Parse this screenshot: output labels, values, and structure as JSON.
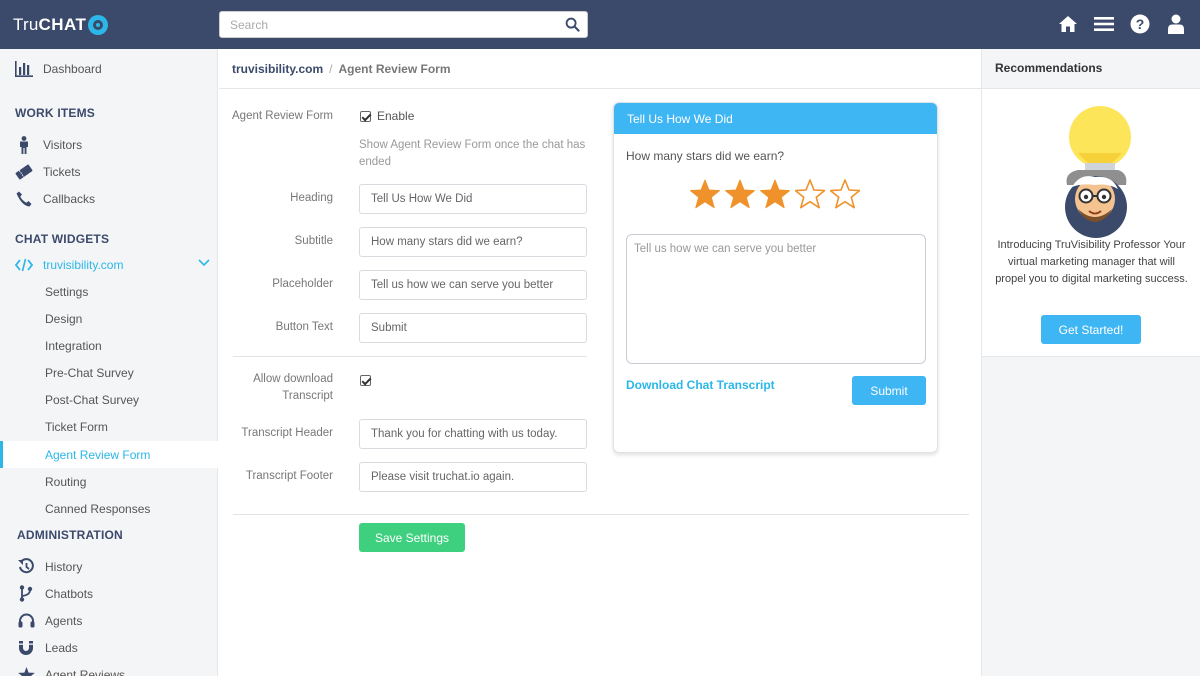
{
  "app": {
    "logo_tru": "Tru",
    "logo_chat": "CHAT"
  },
  "search": {
    "placeholder": "Search"
  },
  "topbar_icons": [
    "home-icon",
    "menu-icon",
    "help-icon",
    "user-icon"
  ],
  "sidebar": {
    "dashboard": "Dashboard",
    "work_items_title": "WORK ITEMS",
    "work_items": [
      "Visitors",
      "Tickets",
      "Callbacks"
    ],
    "chat_widgets_title": "CHAT WIDGETS",
    "widget_name": "truvisibility.com",
    "widget_items": [
      "Settings",
      "Design",
      "Integration",
      "Pre-Chat Survey",
      "Post-Chat Survey",
      "Ticket Form",
      "Agent Review Form",
      "Routing",
      "Canned Responses"
    ],
    "active_item": "Agent Review Form",
    "administration_title": "ADMINISTRATION",
    "admin_items": [
      "History",
      "Chatbots",
      "Agents",
      "Leads",
      "Agent Reviews"
    ]
  },
  "breadcrumb": {
    "site": "truvisibility.com",
    "separator": "/",
    "page": "Agent Review Form"
  },
  "form": {
    "agent_review_label": "Agent Review Form",
    "enable_label": "Enable",
    "enable_checked": true,
    "help_text": "Show Agent Review Form once the chat has ended",
    "heading_label": "Heading",
    "heading_value": "Tell Us How We Did",
    "subtitle_label": "Subtitle",
    "subtitle_value": "How many stars did we earn?",
    "placeholder_label": "Placeholder",
    "placeholder_value": "Tell us how we can serve you better",
    "button_text_label": "Button Text",
    "button_text_value": "Submit",
    "allow_download_label": "Allow download Transcript",
    "allow_download_checked": true,
    "transcript_header_label": "Transcript Header",
    "transcript_header_value": "Thank you for chatting with us today.",
    "transcript_footer_label": "Transcript Footer",
    "transcript_footer_value": "Please visit truchat.io again.",
    "save_label": "Save Settings"
  },
  "preview": {
    "heading": "Tell Us How We Did",
    "question": "How many stars did we earn?",
    "rating": 3,
    "max_stars": 5,
    "textarea_placeholder": "Tell us how we can serve you better",
    "download_link": "Download Chat Transcript",
    "submit_label": "Submit"
  },
  "recommendations": {
    "title": "Recommendations",
    "text": "Introducing TruVisibility Professor Your virtual marketing manager that will propel you to digital marketing success.",
    "button_label": "Get Started!"
  },
  "colors": {
    "topbar": "#3b4a6b",
    "accent": "#2cb7e8",
    "widget_blue": "#3fb6f4",
    "save_green": "#3fd07f",
    "star_orange": "#f0922b"
  }
}
